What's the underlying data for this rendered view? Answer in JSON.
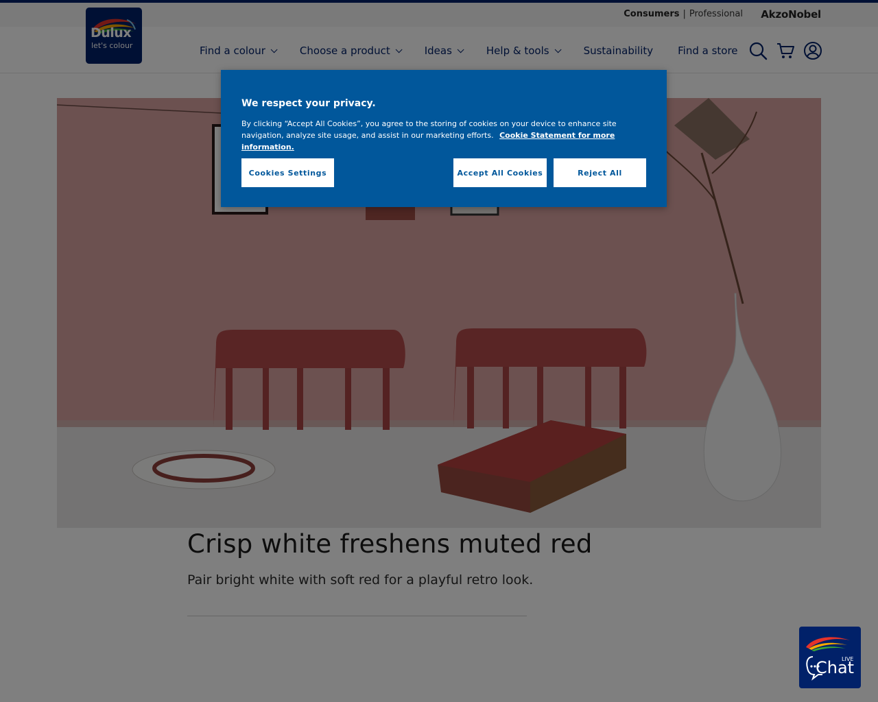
{
  "header": {
    "utility": {
      "consumers": "Consumers",
      "separator": "|",
      "professional": "Professional",
      "corporate": "AkzoNobel"
    },
    "logo": {
      "name": "Dulux",
      "tagline": "let's colour"
    },
    "nav": [
      {
        "label": "Find a colour",
        "has_dropdown": true
      },
      {
        "label": "Choose a product",
        "has_dropdown": true
      },
      {
        "label": "Ideas",
        "has_dropdown": true
      },
      {
        "label": "Help & tools",
        "has_dropdown": true
      },
      {
        "label": "Sustainability",
        "has_dropdown": false
      },
      {
        "label": "Find a store",
        "has_dropdown": false
      }
    ],
    "icons": [
      "search-icon",
      "cart-icon",
      "account-icon"
    ]
  },
  "article": {
    "title": "Crisp white freshens muted red",
    "subtitle": "Pair bright white with soft red for a playful retro look."
  },
  "cookie_banner": {
    "title": "We respect your privacy.",
    "body": "By clicking “Accept All Cookies”, you agree to the storing of cookies on your device to enhance site navigation, analyze site usage, and assist in our marketing efforts.",
    "link": "Cookie Statement for more information.",
    "settings_button": "Cookies Settings",
    "accept_button": "Accept All Cookies",
    "reject_button": "Reject All"
  },
  "chat": {
    "label": "LIVE",
    "word": "Chat"
  },
  "colors": {
    "brand_navy": "#012169",
    "banner_blue": "#01579b",
    "hero_wall": "#dba7a4"
  }
}
